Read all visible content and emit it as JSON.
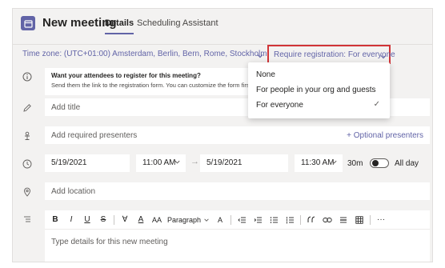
{
  "header": {
    "title": "New meeting",
    "tabs": [
      {
        "label": "Details",
        "active": true
      },
      {
        "label": "Scheduling Assistant",
        "active": false
      }
    ]
  },
  "timezone": {
    "label": "Time zone: (UTC+01:00) Amsterdam, Berlin, Bern, Rome, Stockholm, Vienna"
  },
  "registration": {
    "label": "Require registration: For everyone",
    "options": [
      {
        "label": "None",
        "selected": false
      },
      {
        "label": "For people in your org and guests",
        "selected": false
      },
      {
        "label": "For everyone",
        "selected": true
      }
    ],
    "check_glyph": "✓"
  },
  "info": {
    "title": "Want your attendees to register for this meeting?",
    "body": "Send them the link to the registration form. You can customize the form first to"
  },
  "form": {
    "title_placeholder": "Add title",
    "presenters_placeholder": "Add required presenters",
    "optional_presenters": "+ Optional presenters",
    "start_date": "5/19/2021",
    "start_time": "11:00 AM",
    "end_date": "5/19/2021",
    "end_time": "11:30 AM",
    "duration": "30m",
    "all_day_label": "All day",
    "all_day": false,
    "location_placeholder": "Add location"
  },
  "editor": {
    "toolbar": {
      "bold": "B",
      "italic": "I",
      "underline": "U",
      "strike": "S",
      "highlight": "∀",
      "font_color": "A",
      "font_size": "AA",
      "paragraph": "Paragraph",
      "styles": "A",
      "more": "···"
    },
    "placeholder": "Type details for this new meeting"
  },
  "icons": {
    "app": "calendar-icon",
    "info": "info-icon",
    "title": "pencil-icon",
    "presenters": "presenter-icon",
    "time": "clock-icon",
    "location": "location-pin-icon",
    "details": "text-lines-icon"
  },
  "colors": {
    "accent": "#6264a7",
    "highlight_border": "#d13438",
    "background": "#f3f2f1"
  }
}
